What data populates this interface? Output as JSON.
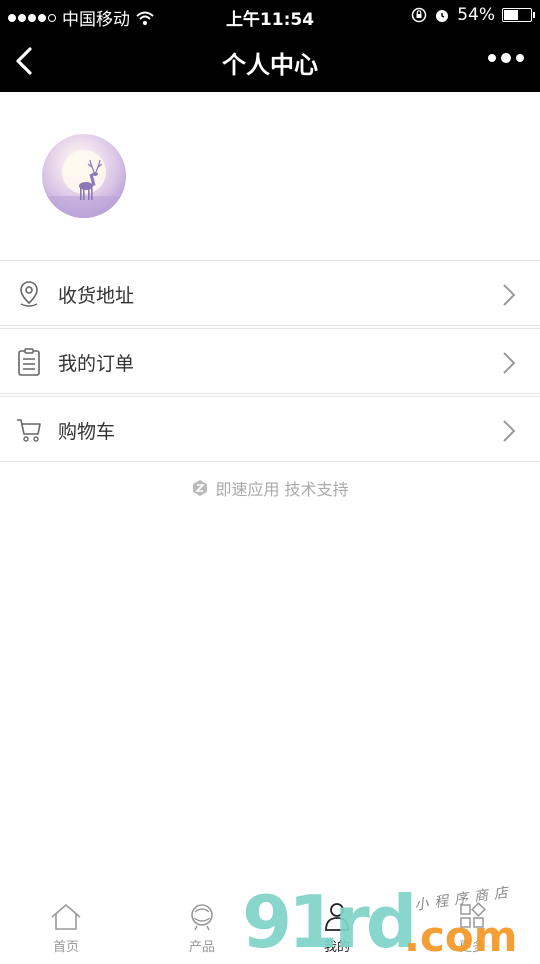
{
  "status_bar": {
    "carrier": "中国移动",
    "time": "上午11:54",
    "battery": "54%",
    "battery_level": 0.54
  },
  "nav": {
    "title": "个人中心"
  },
  "menu": [
    {
      "label": "收货地址",
      "icon": "location-pin-icon"
    },
    {
      "label": "我的订单",
      "icon": "clipboard-icon"
    },
    {
      "label": "购物车",
      "icon": "cart-icon"
    }
  ],
  "support": {
    "text": "即速应用 技术支持"
  },
  "tabs": [
    {
      "label": "首页",
      "icon": "home-icon"
    },
    {
      "label": "产品",
      "icon": "product-icon"
    },
    {
      "label": "我的",
      "icon": "person-icon",
      "active": true
    },
    {
      "label": "更多",
      "icon": "grid-icon"
    }
  ],
  "watermark": {
    "brand": "91rd",
    "domain": ".com",
    "tagline": "小程序商店"
  },
  "colors": {
    "header_bg": "#000000",
    "divider": "#e6e6e6",
    "label_text": "#333333",
    "muted_text": "#aaaaaa",
    "watermark_teal": "#7fd3c9",
    "watermark_green": "#8fd36a",
    "watermark_orange": "#f39a2c"
  }
}
